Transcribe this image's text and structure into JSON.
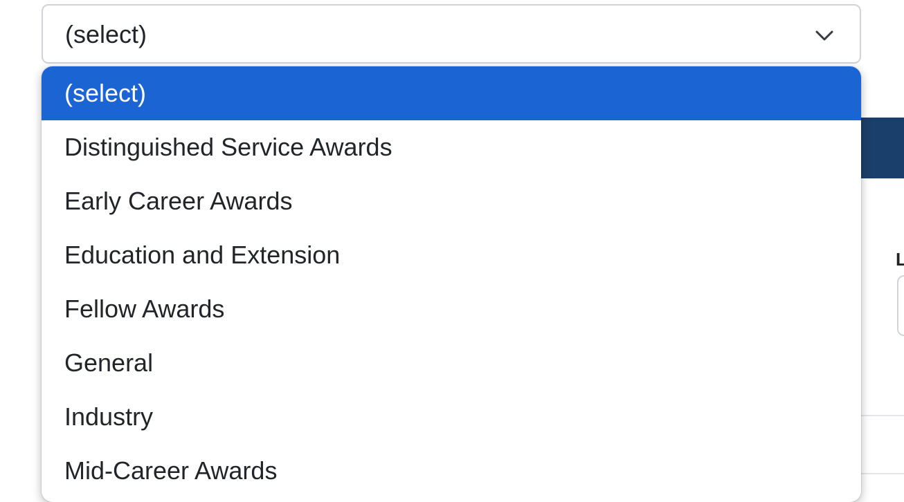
{
  "select": {
    "value": "(select)",
    "chevron_icon": "chevron-down-icon"
  },
  "dropdown": {
    "highlight_color": "#1a64d4",
    "options": [
      {
        "label": "(select)",
        "selected": true
      },
      {
        "label": "Distinguished Service Awards",
        "selected": false
      },
      {
        "label": "Early Career Awards",
        "selected": false
      },
      {
        "label": "Education and Extension",
        "selected": false
      },
      {
        "label": "Fellow Awards",
        "selected": false
      },
      {
        "label": "General",
        "selected": false
      },
      {
        "label": "Industry",
        "selected": false
      },
      {
        "label": "Mid-Career Awards",
        "selected": false
      }
    ]
  },
  "background": {
    "label_fragment": "L"
  }
}
